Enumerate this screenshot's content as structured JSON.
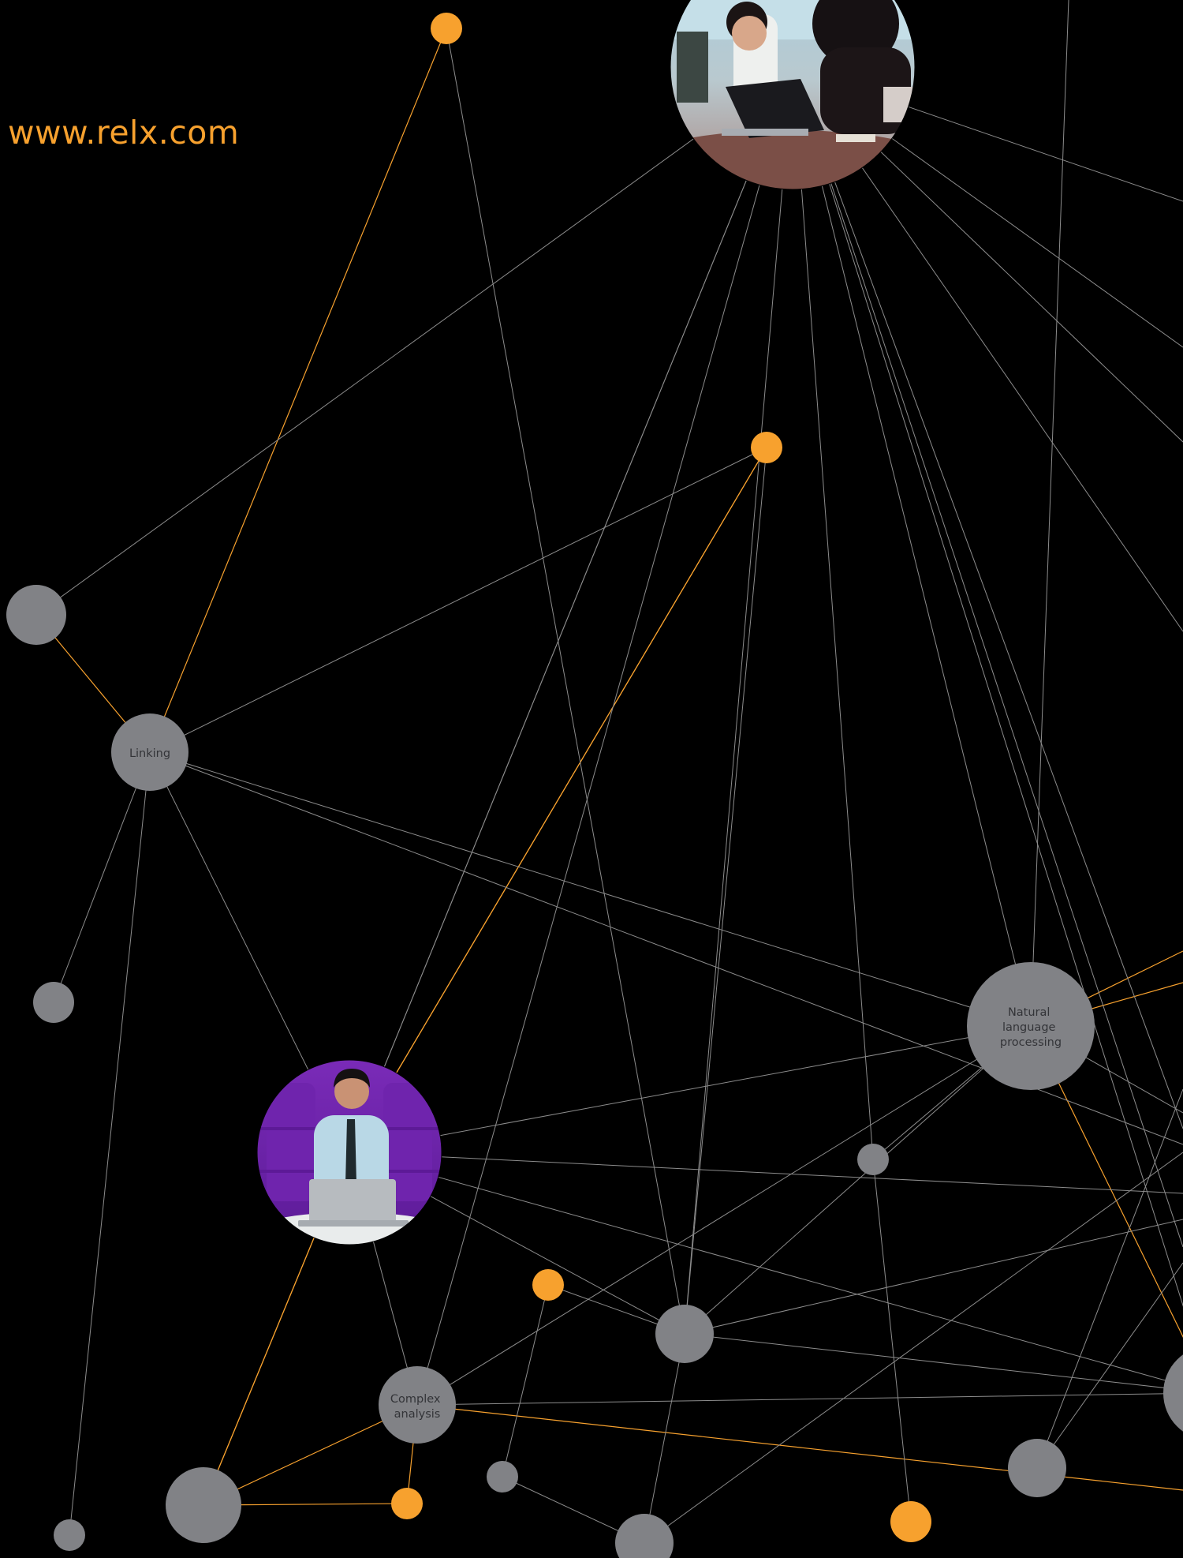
{
  "website": "www.relx.com",
  "colors": {
    "background": "#000000",
    "accent": "#F7A12E",
    "node_gray": "#818286",
    "edge_gray": "#8C8C8C",
    "label_text": "#333438"
  },
  "node_labels": {
    "linking": [
      "Linking"
    ],
    "nlp": [
      "Natural",
      "language",
      "processing"
    ],
    "complex": [
      "Complex",
      "analysis"
    ]
  },
  "photos": {
    "top": "two-women-meeting-photo",
    "middle": "man-with-laptop-photo"
  }
}
